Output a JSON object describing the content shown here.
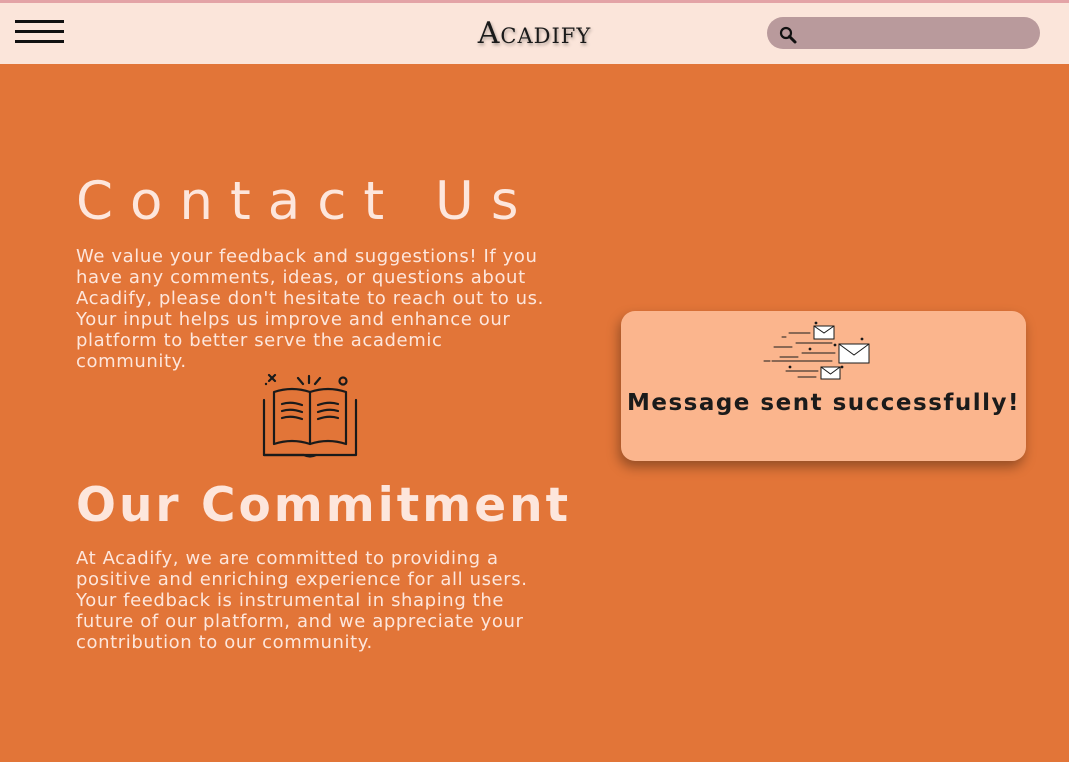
{
  "header": {
    "logo": "Acadify",
    "search": {
      "placeholder": "",
      "value": ""
    }
  },
  "icons": {
    "menu": "hamburger-menu-icon",
    "search": "magnifier-icon",
    "book": "open-book-icon",
    "mail": "flying-envelopes-icon"
  },
  "contact": {
    "title": "Contact Us",
    "body": "We value your feedback and suggestions! If you have any comments, ideas, or questions about Acadify, please don't hesitate to reach out to us. Your input helps us improve and enhance our platform to better serve the academic community."
  },
  "commitment": {
    "title": "Our Commitment",
    "body": "At Acadify, we are committed to providing a positive and enriching experience for all users. Your feedback is instrumental in shaping the future of our platform, and we appreciate your contribution to our community."
  },
  "toast": {
    "message": "Message sent successfully!"
  },
  "colors": {
    "background": "#e27538",
    "header": "#fbe5da",
    "text_light": "#fde6dc",
    "toast": "#fbb58d",
    "search_field": "#b99a9c"
  }
}
